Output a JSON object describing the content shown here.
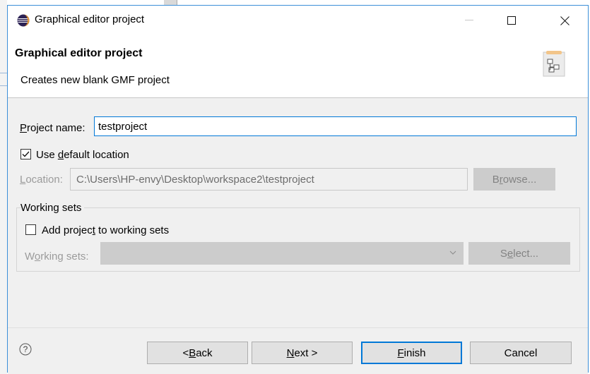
{
  "window": {
    "title": "Graphical editor project",
    "controls": [
      "minimize-icon",
      "maximize-icon",
      "close-icon"
    ]
  },
  "header": {
    "title": "Graphical editor project",
    "description": "Creates new blank GMF project",
    "image": "wizard-banner-icon"
  },
  "form": {
    "project_name": {
      "label_pre": "",
      "label_mnemonic": "P",
      "label_post": "roject name:",
      "value": "testproject"
    },
    "use_default_location": {
      "label_pre": "Use ",
      "label_mnemonic": "d",
      "label_post": "efault location",
      "checked": true
    },
    "location": {
      "label_mnemonic": "L",
      "label_post": "ocation:",
      "value": "C:\\Users\\HP-envy\\Desktop\\workspace2\\testproject",
      "enabled": false
    },
    "browse_button": {
      "pre": "B",
      "mnemonic": "r",
      "post": "owse...",
      "enabled": false
    }
  },
  "working_sets": {
    "group_title": "Working sets",
    "add_checkbox": {
      "label_pre": "Add projec",
      "label_mnemonic": "t",
      "label_post": " to working sets",
      "checked": false
    },
    "field": {
      "label_pre": "W",
      "label_mnemonic": "o",
      "label_post": "rking sets:",
      "value": "",
      "enabled": false
    },
    "select_button": {
      "pre": "S",
      "mnemonic": "e",
      "post": "lect...",
      "enabled": false
    }
  },
  "footer": {
    "help_icon": "help-icon",
    "back": {
      "pre": "< ",
      "mnemonic": "B",
      "post": "ack"
    },
    "next": {
      "pre": "",
      "mnemonic": "N",
      "post": "ext >"
    },
    "finish": {
      "pre": "",
      "mnemonic": "F",
      "post": "inish"
    },
    "cancel": "Cancel"
  },
  "colors": {
    "accent": "#0078d7",
    "window_border": "#3c8fd8",
    "dialog_bg": "#f0f0f0",
    "disabled_text": "#838383"
  }
}
